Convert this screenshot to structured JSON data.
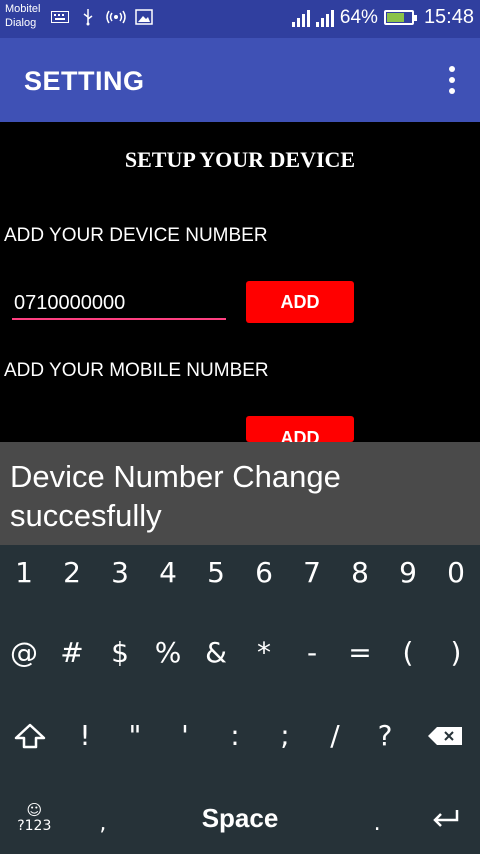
{
  "status_bar": {
    "carrier_1": "Mobitel",
    "carrier_2": "Dialog",
    "battery_percent": "64%",
    "time": "15:48",
    "icons": [
      "keyboard-icon",
      "usb-icon",
      "hotspot-icon",
      "image-icon",
      "signal-icon",
      "signal-icon",
      "battery-icon"
    ]
  },
  "app_bar": {
    "title": "SETTING",
    "menu_icon": "overflow-menu-icon"
  },
  "main": {
    "heading": "SETUP YOUR DEVICE",
    "device_label": "ADD YOUR DEVICE NUMBER",
    "device_value": "0710000000",
    "device_button": "ADD",
    "mobile_label": "ADD YOUR MOBILE NUMBER",
    "mobile_button": "ADD"
  },
  "toast": {
    "message": "Device Number Change succesfully"
  },
  "keyboard": {
    "row1": [
      "1",
      "2",
      "3",
      "4",
      "5",
      "6",
      "7",
      "8",
      "9",
      "0"
    ],
    "row2": [
      "@",
      "#",
      "$",
      "%",
      "&",
      "*",
      "-",
      "=",
      "(",
      ")"
    ],
    "row3": [
      "!",
      "\"",
      "'",
      ":",
      ";",
      "/",
      "?"
    ],
    "mode_key": "?123",
    "comma": ",",
    "space": "Space",
    "period": "."
  },
  "colors": {
    "status_bar": "#303f9f",
    "app_bar": "#3f51b5",
    "button": "#ff0000",
    "input_underline": "#ff4081",
    "keyboard_bg": "#263238",
    "toast_bg": "#4a4a4a"
  }
}
